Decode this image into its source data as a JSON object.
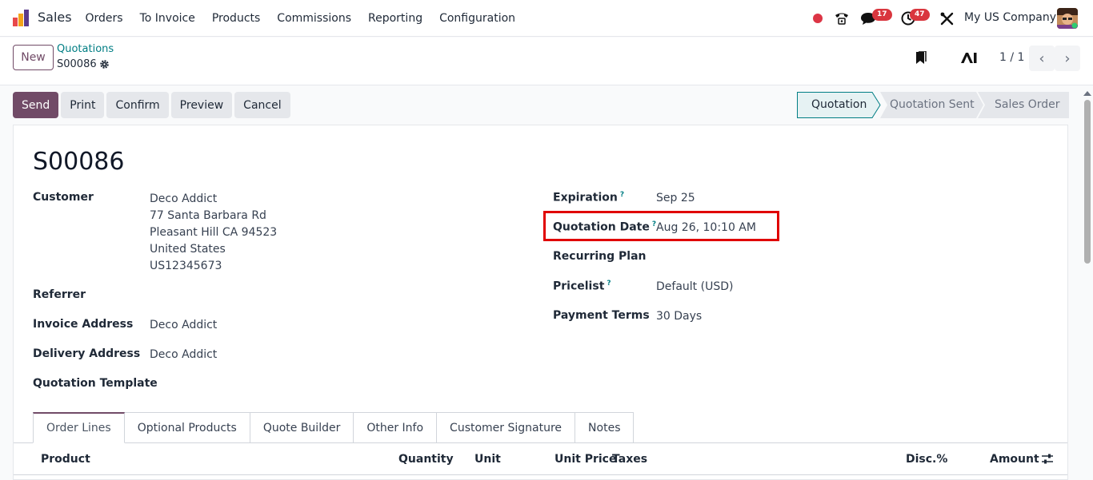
{
  "navbar": {
    "app_name": "Sales",
    "menu": [
      "Orders",
      "To Invoice",
      "Products",
      "Commissions",
      "Reporting",
      "Configuration"
    ],
    "messages_badge": "17",
    "activities_badge": "47",
    "company": "My US Company"
  },
  "control": {
    "new_label": "New",
    "breadcrumb_parent": "Quotations",
    "breadcrumb_current": "S00086",
    "pager": "1 / 1"
  },
  "actions": [
    "Send",
    "Print",
    "Confirm",
    "Preview",
    "Cancel"
  ],
  "status": {
    "stages": [
      "Quotation",
      "Quotation Sent",
      "Sales Order"
    ],
    "active": "Quotation"
  },
  "record": {
    "title": "S00086",
    "left": {
      "customer_label": "Customer",
      "customer_lines": [
        "Deco Addict",
        "77 Santa Barbara Rd",
        "Pleasant Hill CA 94523",
        "United States",
        "US12345673"
      ],
      "referrer_label": "Referrer",
      "invoice_address_label": "Invoice Address",
      "invoice_address": "Deco Addict",
      "delivery_address_label": "Delivery Address",
      "delivery_address": "Deco Addict",
      "quotation_template_label": "Quotation Template"
    },
    "right": {
      "expiration_label": "Expiration",
      "expiration": "Sep 25",
      "quotation_date_label": "Quotation Date",
      "quotation_date": "Aug 26, 10:10 AM",
      "recurring_plan_label": "Recurring Plan",
      "pricelist_label": "Pricelist",
      "pricelist": "Default (USD)",
      "payment_terms_label": "Payment Terms",
      "payment_terms": "30 Days"
    },
    "help_marker": "?"
  },
  "tabs": [
    "Order Lines",
    "Optional Products",
    "Quote Builder",
    "Other Info",
    "Customer Signature",
    "Notes"
  ],
  "table_headers": {
    "product": "Product",
    "quantity": "Quantity",
    "unit": "Unit",
    "unit_price": "Unit Price",
    "taxes": "Taxes",
    "disc": "Disc.%",
    "amount": "Amount"
  },
  "colors": {
    "brand": "#714b67",
    "link": "#017e84",
    "highlight": "#e00000"
  }
}
